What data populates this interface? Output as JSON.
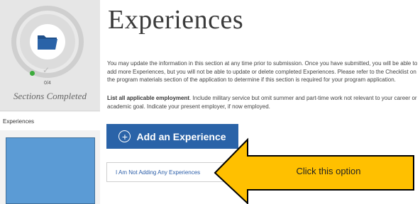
{
  "sidebar": {
    "progress": {
      "completed": 0,
      "total": 4,
      "count_text": "0/4",
      "label": "Sections Completed"
    },
    "items": [
      {
        "label": "Experiences",
        "active": true
      }
    ]
  },
  "main": {
    "title": "Experiences",
    "paragraph1": "You may update the information in this section at any time prior to submission. Once you have submitted, you will be able to add more Experiences, but you will not be able to update or delete completed Experiences. Please refer to the Checklist on the program materials section of the application to determine if this section is required for your program application.",
    "paragraph2_bold": "List all applicable employment",
    "paragraph2_rest": ". Include military service but omit summer and part-time work not relevant to your career or academic goal. Indicate your present employer, if now employed.",
    "add_button_label": "Add an Experience",
    "not_adding_button_label": "I Am Not Adding Any Experiences"
  },
  "annotation": {
    "callout_text": "Click this option",
    "arrow_color": "#ffc000",
    "arrow_outline": "#000000"
  },
  "colors": {
    "primary_button": "#2a63a8",
    "link_text": "#2a5da8",
    "progress_dot": "#3cab3c",
    "sidebar_block": "#5b9bd5",
    "folder_icon": "#2a63a8"
  },
  "icons": [
    "folder-icon",
    "check-icon",
    "plus-circle-icon"
  ]
}
